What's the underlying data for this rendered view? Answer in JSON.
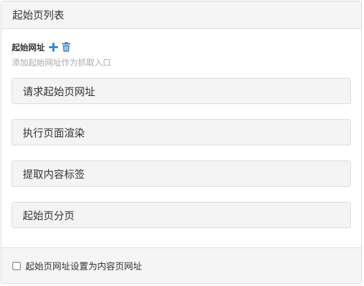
{
  "panel": {
    "title": "起始页列表"
  },
  "field": {
    "label": "起始网址",
    "help": "添加起始网址作为抓取入口",
    "icons": {
      "add": "plus-icon",
      "delete": "trash-icon"
    },
    "icon_color": "#3a87c8"
  },
  "items": [
    {
      "label": "请求起始页网址"
    },
    {
      "label": "执行页面渲染"
    },
    {
      "label": "提取内容标签"
    },
    {
      "label": "起始页分页"
    }
  ],
  "footer": {
    "checkbox_label": "起始页网址设置为内容页网址",
    "checked": false
  }
}
